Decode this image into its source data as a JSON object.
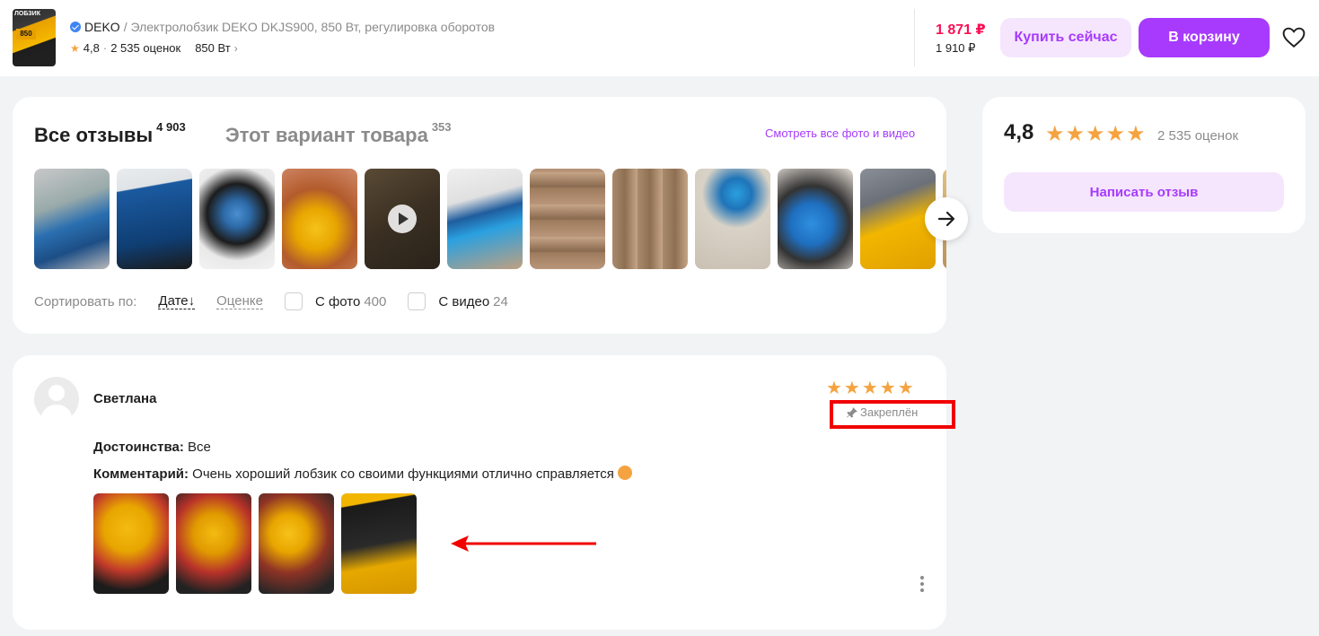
{
  "header": {
    "thumb_text": "ЛОБЗИК",
    "thumb_power": "850",
    "brand": "DEKO",
    "product_title": " / Электролобзик DEKO DKJS900, 850 Вт, регулировка оборотов",
    "rating": "4,8",
    "ratings_count": "2 535 оценок",
    "variant": "850 Вт",
    "price_now": "1 871 ₽",
    "price_old": "1 910 ₽",
    "buy_now_label": "Купить сейчас",
    "cart_label": "В корзину"
  },
  "reviews": {
    "tab_all": "Все отзывы",
    "tab_all_count": "4 903",
    "tab_variant": "Этот вариант товара",
    "tab_variant_count": "353",
    "all_media_link": "Смотреть все фото и видео",
    "sort_label": "Сортировать по:",
    "sort_date": "Дате↓",
    "sort_score": "Оценке",
    "filter_photo": "С фото",
    "filter_photo_count": "400",
    "filter_video": "С видео",
    "filter_video_count": "24"
  },
  "rating_card": {
    "value": "4,8",
    "stars": "★★★★★",
    "count": "2 535 оценок",
    "write_label": "Написать отзыв"
  },
  "review": {
    "author": "Светлана",
    "stars": "★★★★★",
    "pinned": "Закреплён",
    "advantages_label": "Достоинства:",
    "advantages": " Все",
    "comment_label": "Комментарий:",
    "comment": " Очень хороший лобзик со своими функциями отлично справляется"
  },
  "colors": {
    "accent": "#a73afd",
    "price": "#f91155",
    "star": "#f5a340",
    "annotation": "#f10000"
  }
}
